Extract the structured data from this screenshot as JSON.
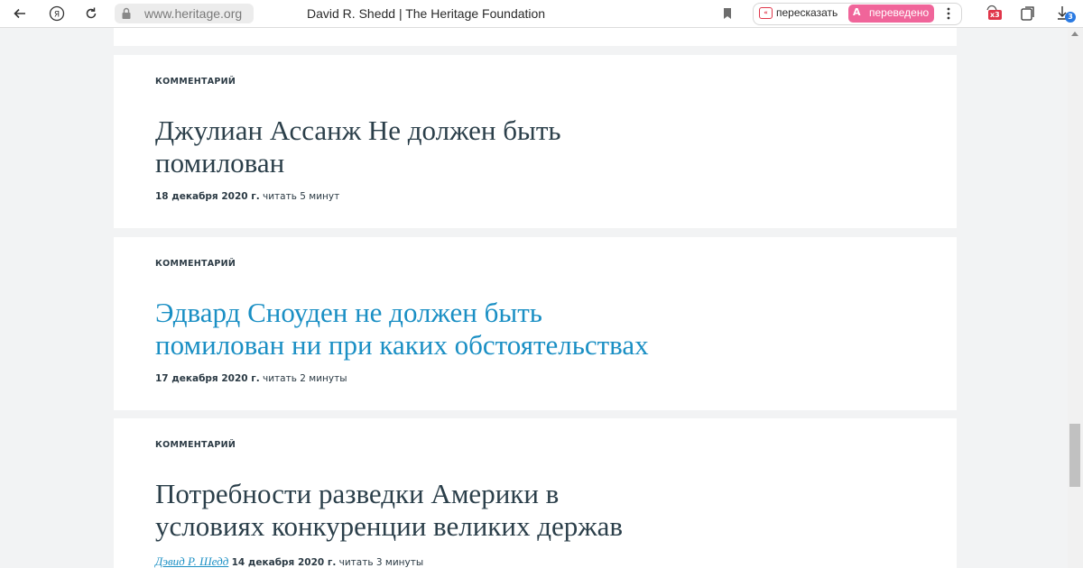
{
  "browser": {
    "url": "www.heritage.org",
    "page_title": "David R. Shedd | The Heritage Foundation",
    "retell_label": "пересказать",
    "translate_glyph": "A",
    "translated_label": "переведено",
    "extensions_badge": "x3",
    "downloads_badge": "3"
  },
  "articles": [
    {
      "kicker": "КОММЕНТАРИЙ",
      "title_line1": "Джулиан Ассанж Не должен быть",
      "title_line2": "помилован",
      "date": "18 декабря 2020 г.",
      "read_time": "читать 5 минут"
    },
    {
      "kicker": "КОММЕНТАРИЙ",
      "title_line1": "Эдвард Сноуден не должен быть",
      "title_line2": "помилован ни при каких обстоятельствах",
      "date": "17 декабря 2020 г.",
      "read_time": "читать 2 минуты"
    },
    {
      "kicker": "КОММЕНТАРИЙ",
      "title_line1": "Потребности разведки Америки в",
      "title_line2": "условиях конкуренции великих держав",
      "author": "Дэвид Р. Шедд",
      "date": "14 декабря 2020 г.",
      "read_time": "читать 3 минуты"
    }
  ],
  "colors": {
    "title_default": "#2b3f4a",
    "title_link": "#1a8fc4",
    "page_background": "#f2f3f4",
    "translated_pill": "#f0659a",
    "badge_red": "#e0364a",
    "badge_blue": "#2a7ae2"
  }
}
